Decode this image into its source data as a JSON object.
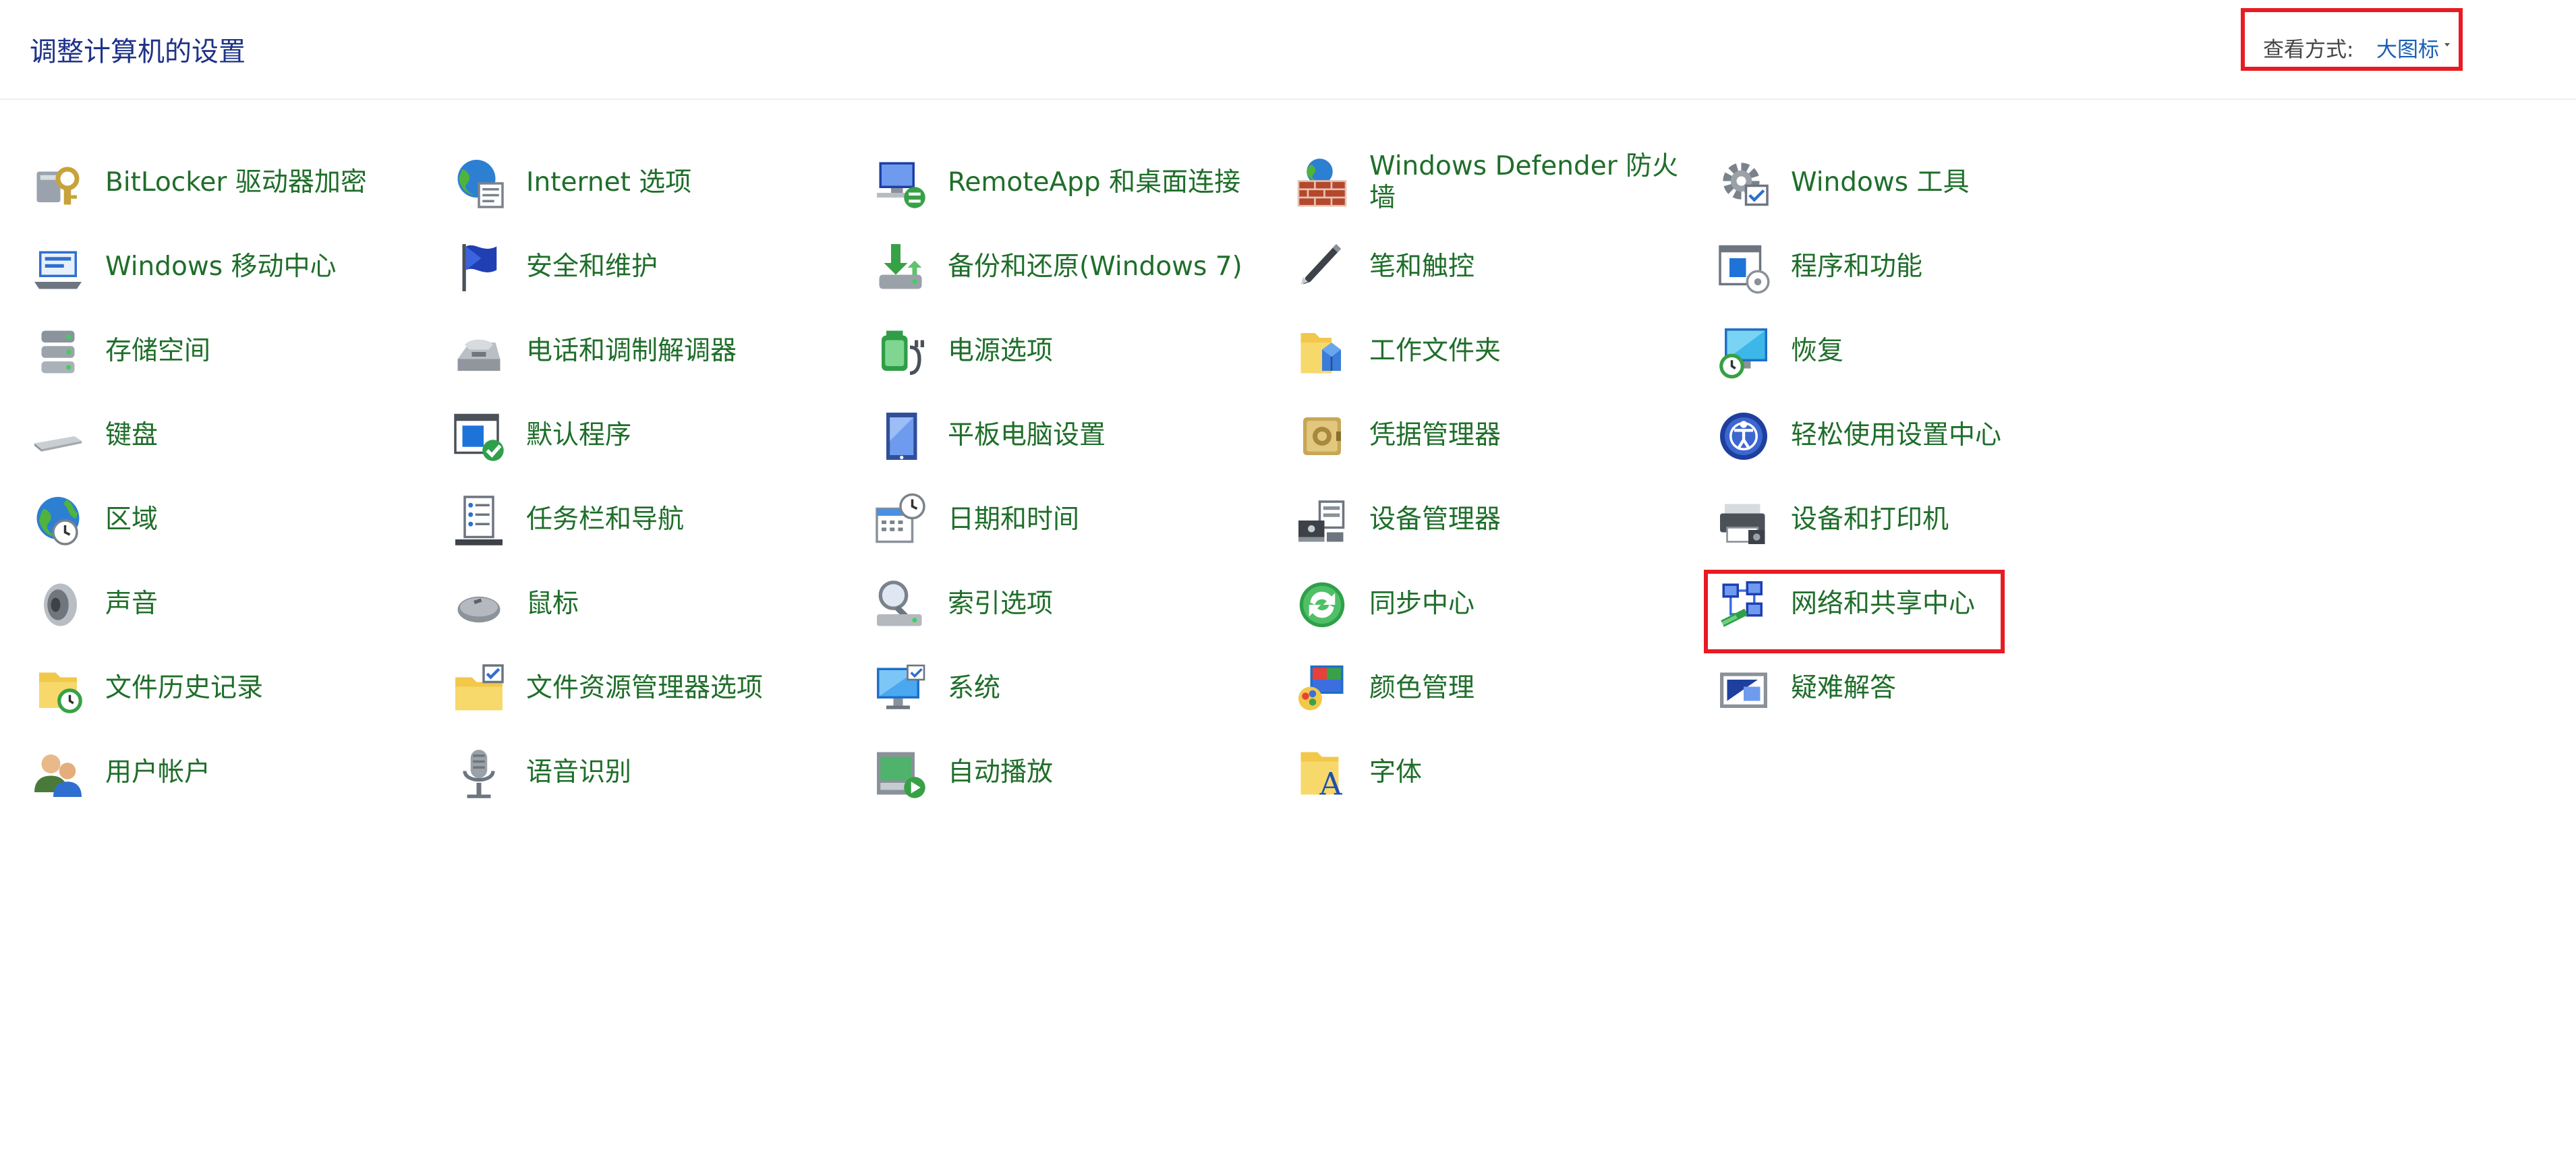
{
  "header": {
    "title": "调整计算机的设置",
    "view_by_label": "查看方式:",
    "view_by_value": "大图标"
  },
  "highlight_color": "#e81b23",
  "columns": [
    [
      {
        "label": "BitLocker 驱动器加密",
        "icon": "bitlocker-icon"
      },
      {
        "label": "Windows 移动中心",
        "icon": "mobility-center-icon"
      },
      {
        "label": "存储空间",
        "icon": "storage-spaces-icon"
      },
      {
        "label": "键盘",
        "icon": "keyboard-icon"
      },
      {
        "label": "区域",
        "icon": "region-icon"
      },
      {
        "label": "声音",
        "icon": "sound-icon"
      },
      {
        "label": "文件历史记录",
        "icon": "file-history-icon"
      },
      {
        "label": "用户帐户",
        "icon": "user-accounts-icon"
      }
    ],
    [
      {
        "label": "Internet 选项",
        "icon": "internet-options-icon"
      },
      {
        "label": "安全和维护",
        "icon": "security-maintenance-icon"
      },
      {
        "label": "电话和调制解调器",
        "icon": "phone-modem-icon"
      },
      {
        "label": "默认程序",
        "icon": "default-programs-icon"
      },
      {
        "label": "任务栏和导航",
        "icon": "taskbar-navigation-icon"
      },
      {
        "label": "鼠标",
        "icon": "mouse-icon"
      },
      {
        "label": "文件资源管理器选项",
        "icon": "file-explorer-options-icon"
      },
      {
        "label": "语音识别",
        "icon": "speech-recognition-icon"
      }
    ],
    [
      {
        "label": "RemoteApp 和桌面连接",
        "icon": "remoteapp-icon"
      },
      {
        "label": "备份和还原(Windows 7)",
        "icon": "backup-restore-icon"
      },
      {
        "label": "电源选项",
        "icon": "power-options-icon"
      },
      {
        "label": "平板电脑设置",
        "icon": "tablet-settings-icon"
      },
      {
        "label": "日期和时间",
        "icon": "date-time-icon"
      },
      {
        "label": "索引选项",
        "icon": "indexing-options-icon"
      },
      {
        "label": "系统",
        "icon": "system-icon"
      },
      {
        "label": "自动播放",
        "icon": "autoplay-icon"
      }
    ],
    [
      {
        "label": "Windows Defender 防火墙",
        "icon": "firewall-icon"
      },
      {
        "label": "笔和触控",
        "icon": "pen-touch-icon"
      },
      {
        "label": "工作文件夹",
        "icon": "work-folders-icon"
      },
      {
        "label": "凭据管理器",
        "icon": "credential-manager-icon"
      },
      {
        "label": "设备管理器",
        "icon": "device-manager-icon"
      },
      {
        "label": "同步中心",
        "icon": "sync-center-icon"
      },
      {
        "label": "颜色管理",
        "icon": "color-management-icon"
      },
      {
        "label": "字体",
        "icon": "fonts-icon"
      }
    ],
    [
      {
        "label": "Windows 工具",
        "icon": "windows-tools-icon"
      },
      {
        "label": "程序和功能",
        "icon": "programs-features-icon"
      },
      {
        "label": "恢复",
        "icon": "recovery-icon"
      },
      {
        "label": "轻松使用设置中心",
        "icon": "ease-of-access-icon"
      },
      {
        "label": "设备和打印机",
        "icon": "devices-printers-icon"
      },
      {
        "label": "网络和共享中心",
        "icon": "network-sharing-icon"
      },
      {
        "label": "疑难解答",
        "icon": "troubleshooting-icon"
      }
    ]
  ]
}
